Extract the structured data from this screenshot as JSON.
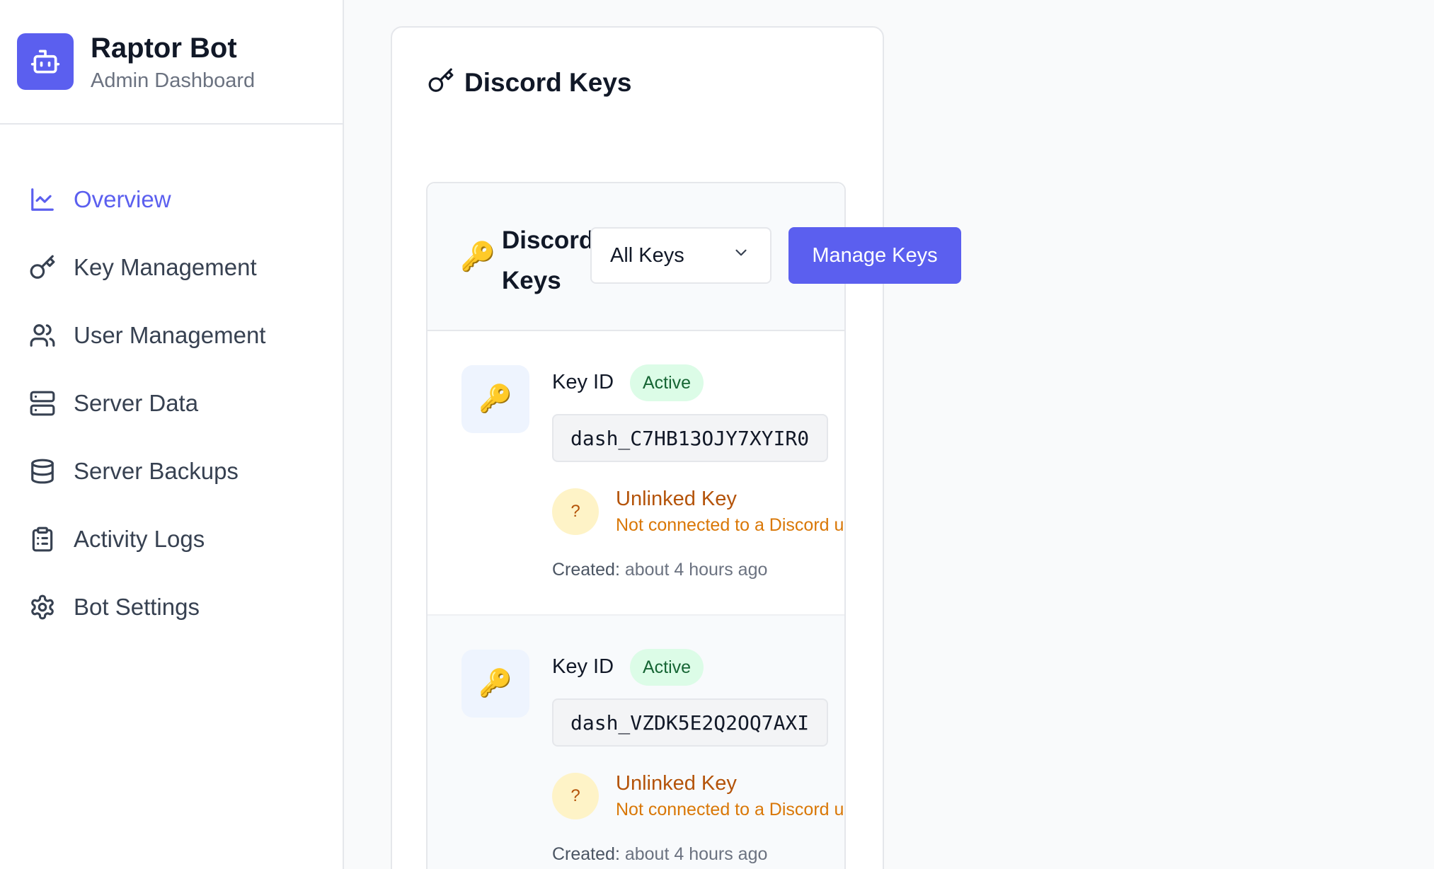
{
  "sidebar": {
    "brand": {
      "title": "Raptor Bot",
      "subtitle": "Admin Dashboard",
      "icon": "robot-icon",
      "accent": "#5b5fef"
    },
    "items": [
      {
        "label": "Overview",
        "icon": "chart-line-icon",
        "active": true
      },
      {
        "label": "Key Management",
        "icon": "key-icon",
        "active": false
      },
      {
        "label": "User Management",
        "icon": "users-icon",
        "active": false
      },
      {
        "label": "Server Data",
        "icon": "server-icon",
        "active": false
      },
      {
        "label": "Server Backups",
        "icon": "database-icon",
        "active": false
      },
      {
        "label": "Activity Logs",
        "icon": "clipboard-icon",
        "active": false
      },
      {
        "label": "Bot Settings",
        "icon": "gear-icon",
        "active": false
      }
    ]
  },
  "panel": {
    "title": "Discord Keys",
    "icon": "key-icon"
  },
  "keys_card": {
    "title": "Discord Keys",
    "filter": {
      "selected": "All Keys",
      "icon": "chevron-down-icon"
    },
    "manage_button": "Manage Keys",
    "items": [
      {
        "label": "Key ID",
        "status": "Active",
        "code": "dash_C7HB13OJY7XYIR0",
        "link_status": "Unlinked Key",
        "link_status_icon": "?",
        "link_detail": "Not connected to a Discord u",
        "created_label": "Created:",
        "created_value": "about 4 hours ago"
      },
      {
        "label": "Key ID",
        "status": "Active",
        "code": "dash_VZDK5E2Q2OQ7AXI",
        "link_status": "Unlinked Key",
        "link_status_icon": "?",
        "link_detail": "Not connected to a Discord u",
        "created_label": "Created:",
        "created_value": "about 4 hours ago"
      }
    ]
  }
}
